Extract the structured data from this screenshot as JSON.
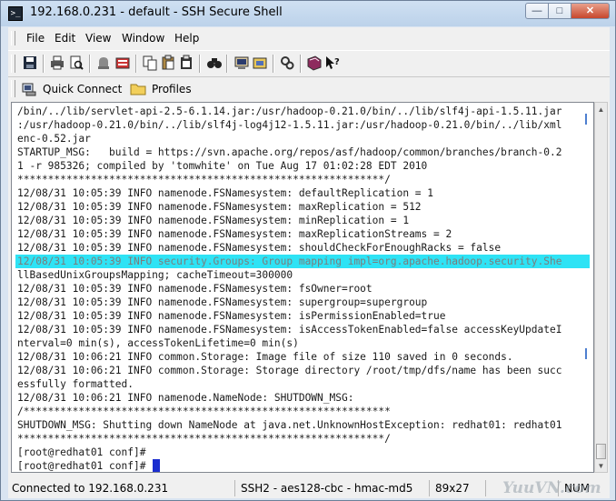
{
  "window": {
    "title": "192.168.0.231 - default - SSH Secure Shell"
  },
  "menu": [
    "File",
    "Edit",
    "View",
    "Window",
    "Help"
  ],
  "toolbar": {
    "icons": [
      "save-icon",
      "print-icon",
      "print-preview-icon",
      "disconnect-icon",
      "settings-icon",
      "copy-icon",
      "paste-icon",
      "paste-clipboard-icon",
      "find-icon",
      "new-terminal-icon",
      "new-file-transfer-icon",
      "profile-settings-icon",
      "help-topics-icon",
      "whats-this-icon"
    ]
  },
  "toolbar2": {
    "quick_connect": "Quick Connect",
    "profiles": "Profiles"
  },
  "terminal": {
    "lines": [
      "/bin/../lib/servlet-api-2.5-6.1.14.jar:/usr/hadoop-0.21.0/bin/../lib/slf4j-api-1.5.11.jar",
      ":/usr/hadoop-0.21.0/bin/../lib/slf4j-log4j12-1.5.11.jar:/usr/hadoop-0.21.0/bin/../lib/xml",
      "enc-0.52.jar",
      "STARTUP_MSG:   build = https://svn.apache.org/repos/asf/hadoop/common/branches/branch-0.2",
      "1 -r 985326; compiled by 'tomwhite' on Tue Aug 17 01:02:28 EDT 2010",
      "************************************************************/",
      "12/08/31 10:05:39 INFO namenode.FSNamesystem: defaultReplication = 1",
      "12/08/31 10:05:39 INFO namenode.FSNamesystem: maxReplication = 512",
      "12/08/31 10:05:39 INFO namenode.FSNamesystem: minReplication = 1",
      "12/08/31 10:05:39 INFO namenode.FSNamesystem: maxReplicationStreams = 2",
      "12/08/31 10:05:39 INFO namenode.FSNamesystem: shouldCheckForEnoughRacks = false",
      "12/08/31 10:05:39 INFO security.Groups: Group mapping impl=org.apache.hadoop.security.She",
      "llBasedUnixGroupsMapping; cacheTimeout=300000",
      "12/08/31 10:05:39 INFO namenode.FSNamesystem: fsOwner=root",
      "12/08/31 10:05:39 INFO namenode.FSNamesystem: supergroup=supergroup",
      "12/08/31 10:05:39 INFO namenode.FSNamesystem: isPermissionEnabled=true",
      "12/08/31 10:05:39 INFO namenode.FSNamesystem: isAccessTokenEnabled=false accessKeyUpdateI",
      "nterval=0 min(s), accessTokenLifetime=0 min(s)",
      "12/08/31 10:06:21 INFO common.Storage: Image file of size 110 saved in 0 seconds.",
      "12/08/31 10:06:21 INFO common.Storage: Storage directory /root/tmp/dfs/name has been succ",
      "essfully formatted.",
      "12/08/31 10:06:21 INFO namenode.NameNode: SHUTDOWN_MSG:",
      "/************************************************************",
      "SHUTDOWN_MSG: Shutting down NameNode at java.net.UnknownHostException: redhat01: redhat01",
      "************************************************************/",
      "[root@redhat01 conf]#",
      "[root@redhat01 conf]#"
    ],
    "highlighted_line": 11
  },
  "status": {
    "connection": "Connected to 192.168.0.231",
    "cipher": "SSH2 - aes128-cbc - hmac-md5",
    "size": "89x27",
    "num": "NUM"
  },
  "watermark": "YuuVN.com"
}
